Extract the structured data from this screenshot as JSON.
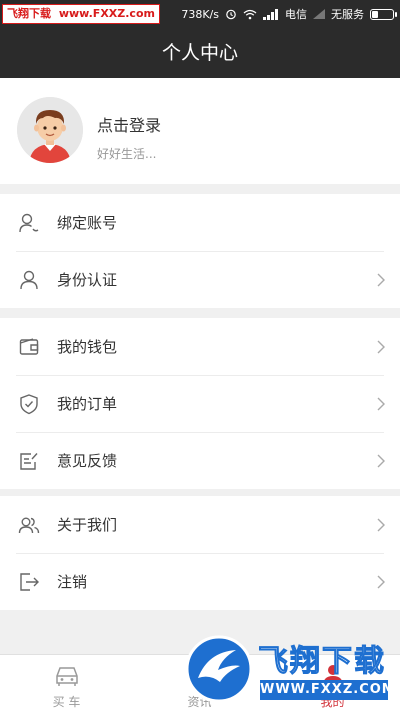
{
  "status_bar": {
    "watermark_cn": "飞翔下载",
    "watermark_url": "www.FXXZ.com",
    "speed": "738K/s",
    "carrier": "电信",
    "service": "无服务"
  },
  "header": {
    "title": "个人中心"
  },
  "profile": {
    "login_label": "点击登录",
    "subtitle": "好好生活..."
  },
  "menu_groups": [
    [
      {
        "name": "bind-account",
        "label": "绑定账号",
        "icon": "user-link-icon",
        "chevron": false
      },
      {
        "name": "identity-verification",
        "label": "身份认证",
        "icon": "user-icon",
        "chevron": true
      }
    ],
    [
      {
        "name": "my-wallet",
        "label": "我的钱包",
        "icon": "wallet-icon",
        "chevron": true
      },
      {
        "name": "my-orders",
        "label": "我的订单",
        "icon": "shield-check-icon",
        "chevron": true
      },
      {
        "name": "feedback",
        "label": "意见反馈",
        "icon": "edit-note-icon",
        "chevron": true
      }
    ],
    [
      {
        "name": "about-us",
        "label": "关于我们",
        "icon": "users-icon",
        "chevron": true
      },
      {
        "name": "logout",
        "label": "注销",
        "icon": "logout-icon",
        "chevron": true
      }
    ]
  ],
  "tab_bar": [
    {
      "label": "买 车",
      "icon": "car-icon",
      "active": false
    },
    {
      "label": "资讯",
      "icon": "news-icon",
      "active": false
    },
    {
      "label": "我的",
      "icon": "profile-icon",
      "active": true
    }
  ],
  "watermark_bottom": {
    "title": "飞翔下载",
    "url": "WWW.FXXZ.COM"
  },
  "colors": {
    "header_bg": "#2b2b2b",
    "active_tab": "#d2323a",
    "page_bg": "#f0f0f0",
    "watermark_blue": "#1e6fd0"
  }
}
